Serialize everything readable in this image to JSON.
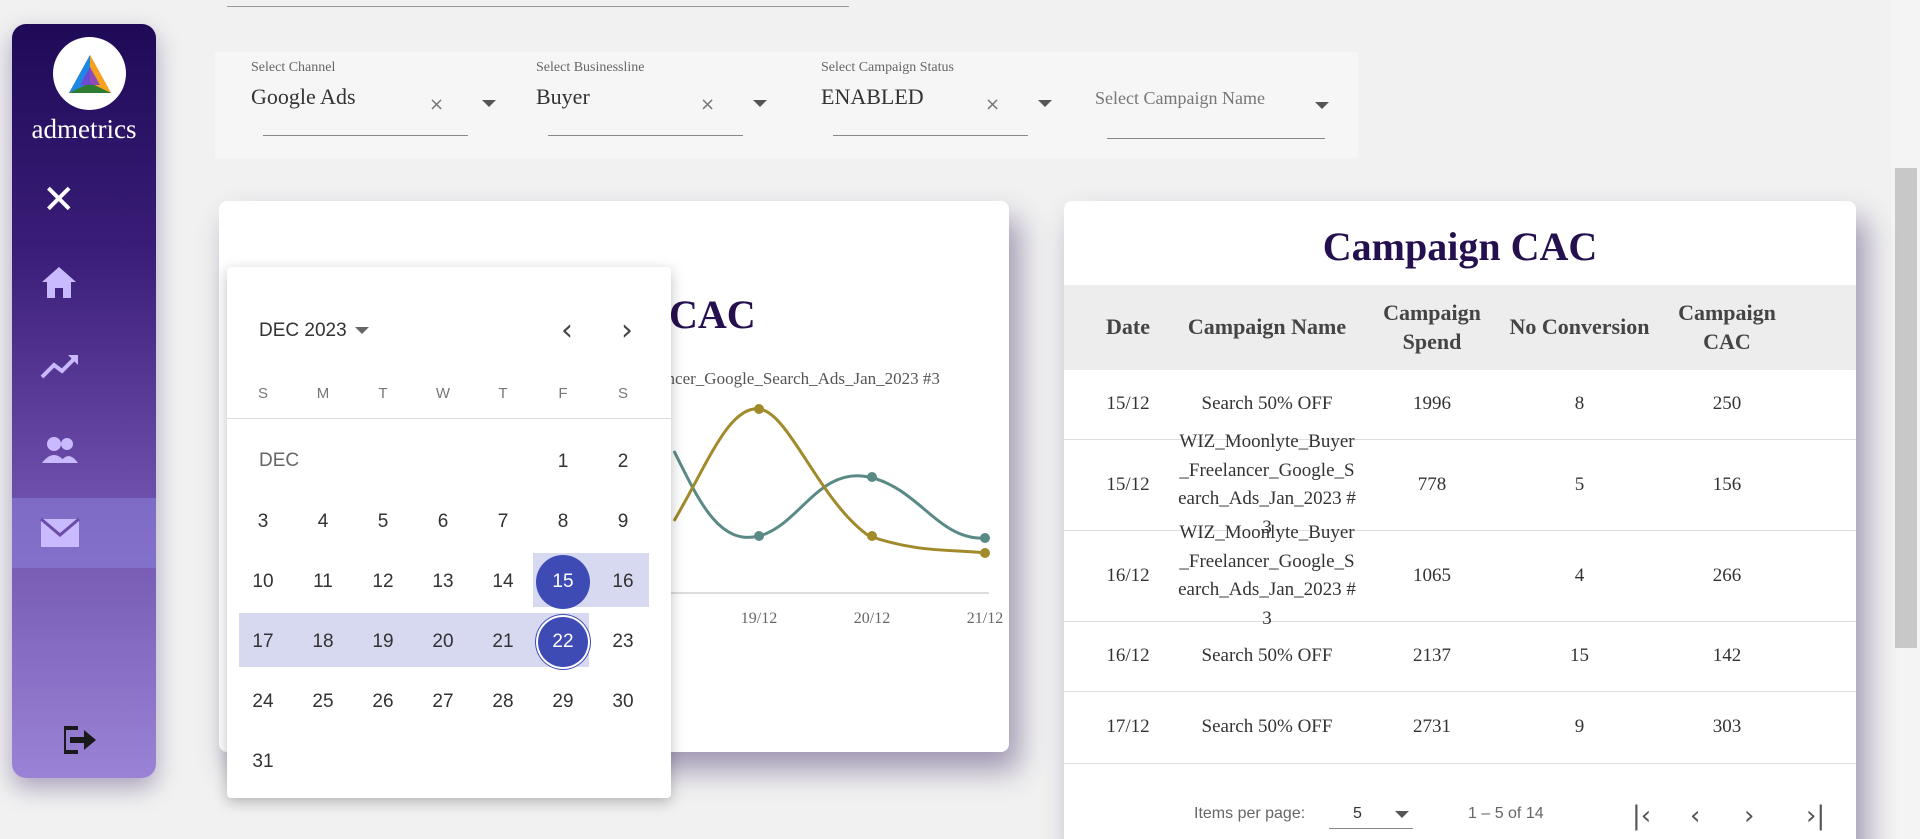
{
  "brand": {
    "name": "admetrics"
  },
  "sidebar": {
    "items": [
      {
        "name": "home",
        "icon": "home-icon"
      },
      {
        "name": "trends",
        "icon": "trending-up-icon"
      },
      {
        "name": "users",
        "icon": "people-icon"
      },
      {
        "name": "mail",
        "icon": "mail-icon",
        "active": true
      }
    ],
    "logout_icon": "logout-icon"
  },
  "filters": {
    "channel": {
      "label": "Select Channel",
      "value": "Google Ads"
    },
    "businessline": {
      "label": "Select Businessline",
      "value": "Buyer"
    },
    "status": {
      "label": "Select Campaign Status",
      "value": "ENABLED"
    },
    "campaign_name": {
      "placeholder": "Select Campaign Name"
    }
  },
  "chart": {
    "title_partial": "CAC",
    "legend_partial": "ancer_Google_Search_Ads_Jan_2023 #3",
    "x_labels_visible": [
      "19/12",
      "20/12",
      "21/12"
    ]
  },
  "chart_data": {
    "type": "line",
    "x": [
      "19/12",
      "20/12",
      "21/12"
    ],
    "series": [
      {
        "color": "#a08a2a",
        "values": [
          1.0,
          0.35,
          0.3
        ]
      },
      {
        "color": "#5a8a86",
        "values": [
          0.3,
          0.75,
          0.42
        ]
      }
    ]
  },
  "calendar": {
    "month_year": "DEC 2023",
    "weekdays": [
      "S",
      "M",
      "T",
      "W",
      "T",
      "F",
      "S"
    ],
    "month_label": "DEC",
    "range_start": 15,
    "range_end": 22
  },
  "table": {
    "title": "Campaign CAC",
    "headers": [
      "Date",
      "Campaign Name",
      "Campaign Spend",
      "No Conversion",
      "Campaign CAC"
    ],
    "rows": [
      {
        "date": "15/12",
        "name": "Search 50% OFF",
        "spend": "1996",
        "conv": "8",
        "cac": "250"
      },
      {
        "date": "15/12",
        "name": "WIZ_Moonlyte_Buyer_Freelancer_Google_Search_Ads_Jan_2023 #3",
        "spend": "778",
        "conv": "5",
        "cac": "156"
      },
      {
        "date": "16/12",
        "name": "WIZ_Moonlyte_Buyer_Freelancer_Google_Search_Ads_Jan_2023 #3",
        "spend": "1065",
        "conv": "4",
        "cac": "266"
      },
      {
        "date": "16/12",
        "name": "Search 50% OFF",
        "spend": "2137",
        "conv": "15",
        "cac": "142"
      },
      {
        "date": "17/12",
        "name": "Search 50% OFF",
        "spend": "2731",
        "conv": "9",
        "cac": "303"
      }
    ],
    "paginator": {
      "items_label": "Items per page:",
      "page_size": "5",
      "range": "1 – 5 of 14"
    }
  }
}
